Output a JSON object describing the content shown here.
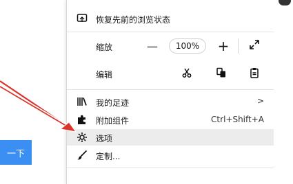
{
  "search": {
    "button_label": "一下"
  },
  "menu": {
    "restore_label": "恢复先前的浏览状态",
    "zoom": {
      "label": "缩放",
      "minus": "—",
      "value": "100%",
      "plus": "+"
    },
    "edit": {
      "label": "编辑"
    },
    "items": [
      {
        "label": "我的足迹",
        "right": ">"
      },
      {
        "label": "附加组件",
        "right": "Ctrl+Shift+A"
      },
      {
        "label": "选项",
        "right": ""
      },
      {
        "label": "定制...",
        "right": ""
      }
    ]
  },
  "colors": {
    "accent": "#3b8ff2",
    "arrow": "#d9352b",
    "highlight": "#ececec"
  }
}
